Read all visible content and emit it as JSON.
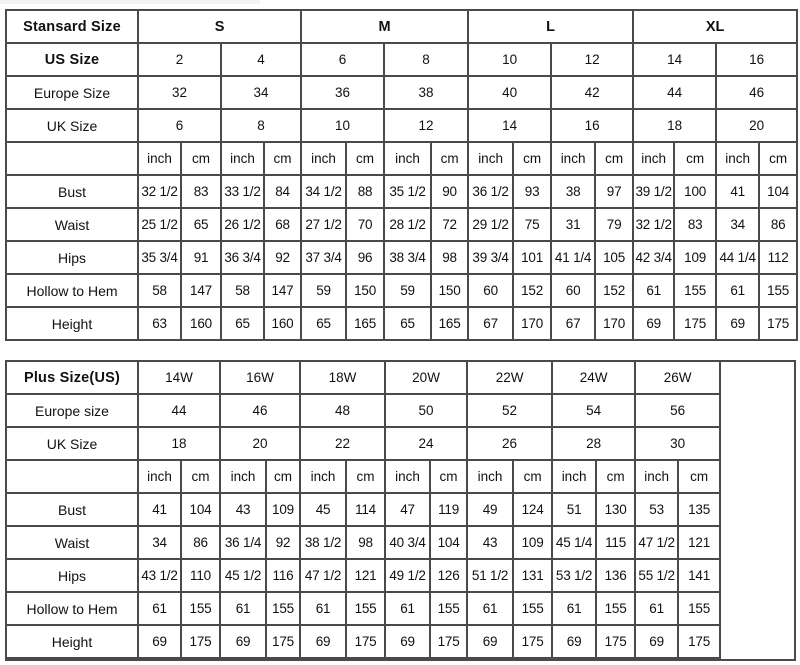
{
  "standard": {
    "header_label": "Stansard Size",
    "letter_sizes": [
      "S",
      "M",
      "L",
      "XL"
    ],
    "us_label": "US Size",
    "us_sizes": [
      "2",
      "4",
      "6",
      "8",
      "10",
      "12",
      "14",
      "16"
    ],
    "europe_label": "Europe Size",
    "europe_sizes": [
      "32",
      "34",
      "36",
      "38",
      "40",
      "42",
      "44",
      "46"
    ],
    "uk_label": "UK Size",
    "uk_sizes": [
      "6",
      "8",
      "10",
      "12",
      "14",
      "16",
      "18",
      "20"
    ],
    "unit_inch": "inch",
    "unit_cm": "cm",
    "rows": [
      {
        "label": "Bust",
        "values": [
          "32 1/2",
          "83",
          "33 1/2",
          "84",
          "34 1/2",
          "88",
          "35 1/2",
          "90",
          "36 1/2",
          "93",
          "38",
          "97",
          "39 1/2",
          "100",
          "41",
          "104"
        ]
      },
      {
        "label": "Waist",
        "values": [
          "25 1/2",
          "65",
          "26 1/2",
          "68",
          "27 1/2",
          "70",
          "28 1/2",
          "72",
          "29 1/2",
          "75",
          "31",
          "79",
          "32 1/2",
          "83",
          "34",
          "86"
        ]
      },
      {
        "label": "Hips",
        "values": [
          "35 3/4",
          "91",
          "36 3/4",
          "92",
          "37 3/4",
          "96",
          "38 3/4",
          "98",
          "39 3/4",
          "101",
          "41 1/4",
          "105",
          "42 3/4",
          "109",
          "44 1/4",
          "112"
        ]
      },
      {
        "label": "Hollow to Hem",
        "values": [
          "58",
          "147",
          "58",
          "147",
          "59",
          "150",
          "59",
          "150",
          "60",
          "152",
          "60",
          "152",
          "61",
          "155",
          "61",
          "155"
        ]
      },
      {
        "label": "Height",
        "values": [
          "63",
          "160",
          "65",
          "160",
          "65",
          "165",
          "65",
          "165",
          "67",
          "170",
          "67",
          "170",
          "69",
          "175",
          "69",
          "175"
        ]
      }
    ]
  },
  "plus": {
    "header_label": "Plus Size(US)",
    "us_sizes": [
      "14W",
      "16W",
      "18W",
      "20W",
      "22W",
      "24W",
      "26W"
    ],
    "europe_label": "Europe size",
    "europe_sizes": [
      "44",
      "46",
      "48",
      "50",
      "52",
      "54",
      "56"
    ],
    "uk_label": "UK Size",
    "uk_sizes": [
      "18",
      "20",
      "22",
      "24",
      "26",
      "28",
      "30"
    ],
    "unit_inch": "inch",
    "unit_cm": "cm",
    "rows": [
      {
        "label": "Bust",
        "values": [
          "41",
          "104",
          "43",
          "109",
          "45",
          "114",
          "47",
          "119",
          "49",
          "124",
          "51",
          "130",
          "53",
          "135"
        ]
      },
      {
        "label": "Waist",
        "values": [
          "34",
          "86",
          "36 1/4",
          "92",
          "38 1/2",
          "98",
          "40 3/4",
          "104",
          "43",
          "109",
          "45 1/4",
          "115",
          "47 1/2",
          "121"
        ]
      },
      {
        "label": "Hips",
        "values": [
          "43 1/2",
          "110",
          "45 1/2",
          "116",
          "47 1/2",
          "121",
          "49 1/2",
          "126",
          "51 1/2",
          "131",
          "53 1/2",
          "136",
          "55 1/2",
          "141"
        ]
      },
      {
        "label": "Hollow to Hem",
        "values": [
          "61",
          "155",
          "61",
          "155",
          "61",
          "155",
          "61",
          "155",
          "61",
          "155",
          "61",
          "155",
          "61",
          "155"
        ]
      },
      {
        "label": "Height",
        "values": [
          "69",
          "175",
          "69",
          "175",
          "69",
          "175",
          "69",
          "175",
          "69",
          "175",
          "69",
          "175",
          "69",
          "175"
        ]
      }
    ]
  }
}
